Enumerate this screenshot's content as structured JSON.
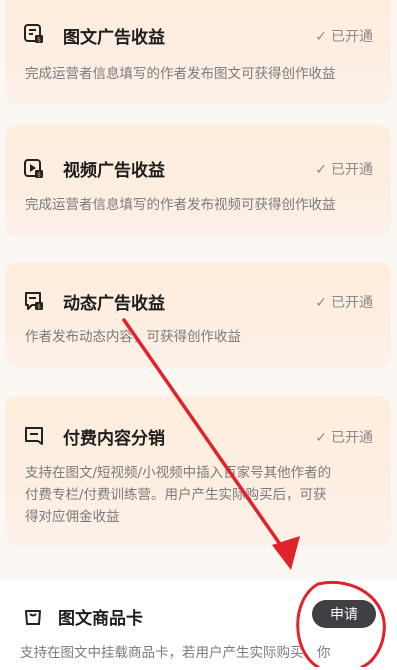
{
  "cards": [
    {
      "title": "图文广告收益",
      "status": "已开通",
      "description": [
        "完成运营者信息填写的作者发布图文可获得创作收益"
      ],
      "icon": "article-ad-icon"
    },
    {
      "title": "视频广告收益",
      "status": "已开通",
      "description": [
        "完成运营者信息填写的作者发布视频可获得创作收益"
      ],
      "icon": "video-ad-icon"
    },
    {
      "title": "动态广告收益",
      "status": "已开通",
      "description": [
        "作者发布动态内容，可获得创作收益"
      ],
      "icon": "dynamic-ad-icon"
    },
    {
      "title": "付费内容分销",
      "status": "已开通",
      "description": [
        "支持在图文/短视频/小视频中插入百家号其他作者的",
        "付费专栏/付费训练营。用户产生实际购买后，可获",
        "得对应佣金收益"
      ],
      "icon": "paid-content-icon"
    }
  ],
  "product_card": {
    "title": "图文商品卡",
    "button": "申请",
    "description": "支持在图文中挂载商品卡，若用户产生实际购买，你",
    "icon": "shopping-bag-icon"
  },
  "colors": {
    "accent": "#e64c33",
    "annotation": "#e0232a",
    "button_bg": "#3f3f44"
  }
}
